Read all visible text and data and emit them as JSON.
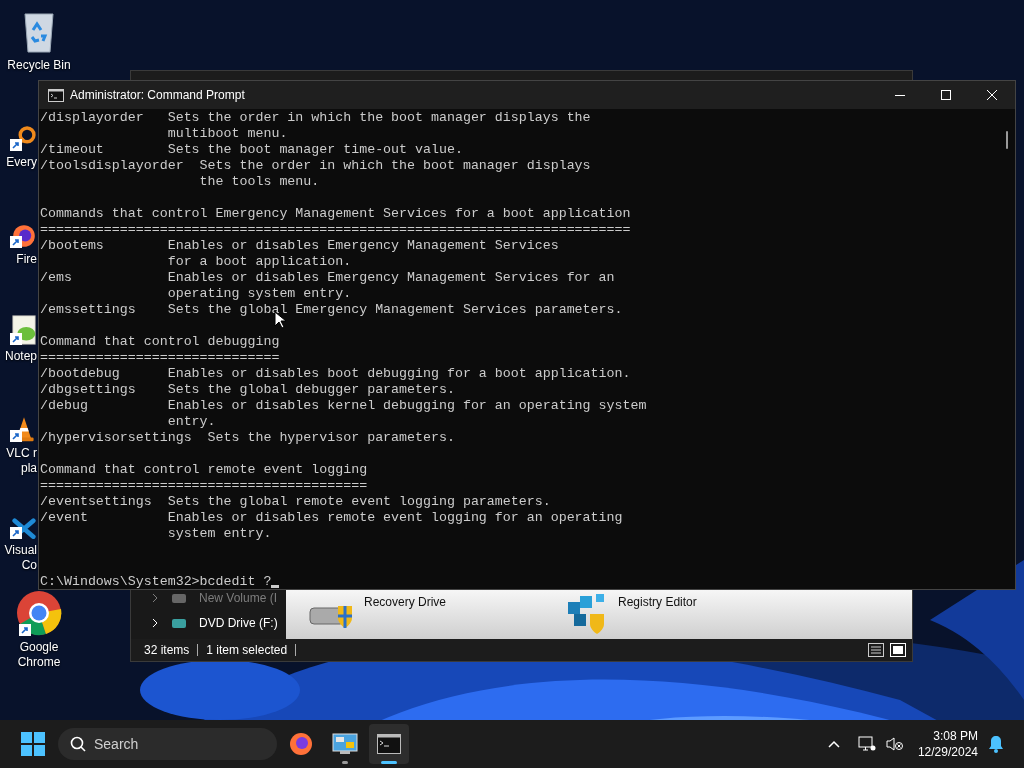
{
  "desktop_icons": [
    {
      "kind": "recycle",
      "shortcut": false,
      "covered": false,
      "lines": [
        "Recycle Bin"
      ]
    },
    {
      "kind": "search",
      "shortcut": true,
      "covered": true,
      "lines": [
        "Every"
      ]
    },
    {
      "kind": "firefox",
      "shortcut": true,
      "covered": true,
      "lines": [
        "Fire"
      ]
    },
    {
      "kind": "notepad",
      "shortcut": true,
      "covered": true,
      "lines": [
        "Notep"
      ]
    },
    {
      "kind": "cone",
      "shortcut": true,
      "covered": true,
      "lines": [
        "VLC r",
        "pla"
      ]
    },
    {
      "kind": "studio",
      "shortcut": true,
      "covered": true,
      "lines": [
        "Visual",
        "Co"
      ]
    },
    {
      "kind": "chrome",
      "shortcut": true,
      "covered": false,
      "lines": [
        "Google",
        "Chrome"
      ]
    }
  ],
  "explorer": {
    "nav_items": [
      {
        "label": "New Volume (I",
        "dimmed": true
      },
      {
        "label": "DVD Drive (F:)",
        "dimmed": false
      }
    ],
    "items": [
      {
        "kind": "drive",
        "label": "Recovery Drive"
      },
      {
        "kind": "cubes",
        "label": "Registry Editor"
      }
    ],
    "status": [
      "32 items",
      "1 item selected"
    ]
  },
  "console": {
    "title": "Administrator: Command Prompt",
    "blocks": [
      [
        "/displayorder   Sets the order in which the boot manager displays the",
        "                multiboot menu.",
        "/timeout        Sets the boot manager time-out value.",
        "/toolsdisplayorder  Sets the order in which the boot manager displays",
        "                    the tools menu."
      ],
      [
        "Commands that control Emergency Management Services for a boot application",
        "==========================================================================",
        "/bootems        Enables or disables Emergency Management Services",
        "                for a boot application.",
        "/ems            Enables or disables Emergency Management Services for an",
        "                operating system entry.",
        "/emssettings    Sets the global Emergency Management Services parameters."
      ],
      [
        "Command that control debugging",
        "==============================",
        "/bootdebug      Enables or disables boot debugging for a boot application.",
        "/dbgsettings    Sets the global debugger parameters.",
        "/debug          Enables or disables kernel debugging for an operating system",
        "                entry.",
        "/hypervisorsettings  Sets the hypervisor parameters."
      ],
      [
        "Command that control remote event logging",
        "=========================================",
        "/eventsettings  Sets the global remote event logging parameters.",
        "/event          Enables or disables remote event logging for an operating",
        "                system entry."
      ]
    ],
    "prompt": "C:\\Windows\\System32>bcdedit ?"
  },
  "taskbar": {
    "search_placeholder": "Search",
    "apps": [
      {
        "kind": "firefox",
        "running": false,
        "selected": false
      },
      {
        "kind": "panel",
        "running": true,
        "selected": false
      },
      {
        "kind": "console",
        "running": true,
        "selected": true
      }
    ],
    "time": "3:08 PM",
    "date": "12/29/2024"
  }
}
